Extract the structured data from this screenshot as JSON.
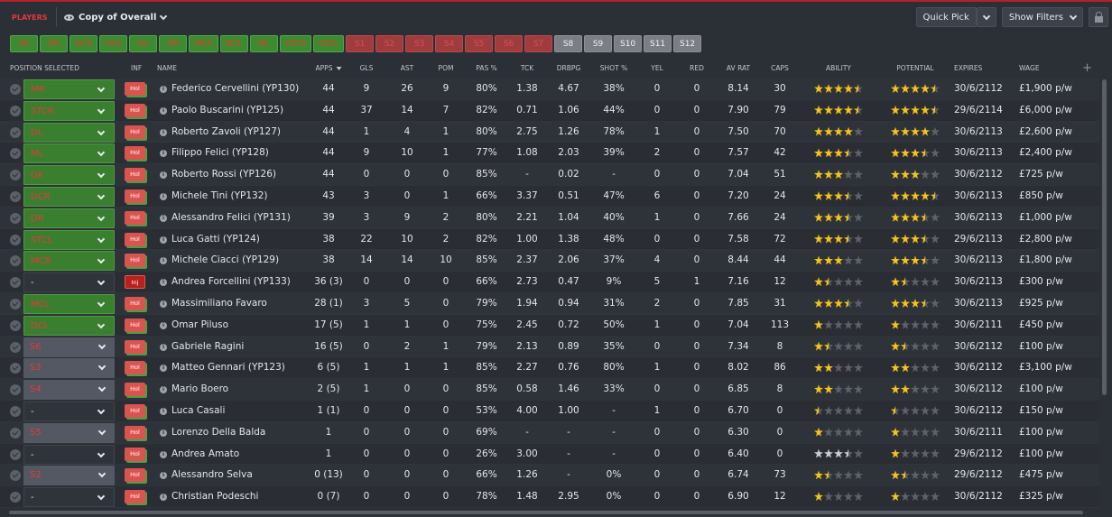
{
  "topbar": {
    "section_tag": "PLAYERS",
    "view_name": "Copy of Overall",
    "quick_pick": "Quick Pick",
    "show_filters": "Show Filters"
  },
  "position_chips": [
    {
      "label": "GK",
      "state": "on"
    },
    {
      "label": "DR",
      "state": "on"
    },
    {
      "label": "DCR",
      "state": "on"
    },
    {
      "label": "DCL",
      "state": "on"
    },
    {
      "label": "DL",
      "state": "on"
    },
    {
      "label": "MR",
      "state": "on"
    },
    {
      "label": "MCR",
      "state": "on"
    },
    {
      "label": "MCL",
      "state": "on"
    },
    {
      "label": "ML",
      "state": "on"
    },
    {
      "label": "STCR",
      "state": "on"
    },
    {
      "label": "STCL",
      "state": "on"
    },
    {
      "label": "S1",
      "state": "off"
    },
    {
      "label": "S2",
      "state": "off"
    },
    {
      "label": "S3",
      "state": "off"
    },
    {
      "label": "S4",
      "state": "off"
    },
    {
      "label": "S5",
      "state": "off"
    },
    {
      "label": "S6",
      "state": "off"
    },
    {
      "label": "S7",
      "state": "off"
    },
    {
      "label": "S8",
      "state": "gray"
    },
    {
      "label": "S9",
      "state": "gray"
    },
    {
      "label": "S10",
      "state": "gray"
    },
    {
      "label": "S11",
      "state": "gray"
    },
    {
      "label": "S12",
      "state": "gray"
    }
  ],
  "columns": {
    "position": "POSITION SELECTED",
    "inf": "INF",
    "name": "NAME",
    "apps": "APPS",
    "gls": "GLS",
    "ast": "AST",
    "pom": "POM",
    "pas": "PAS %",
    "tck": "TCK",
    "drbpg": "DRBPG",
    "shot": "SHOT %",
    "yel": "YEL",
    "red": "RED",
    "avrat": "AV RAT",
    "caps": "CAPS",
    "ability": "ABILITY",
    "potential": "POTENTIAL",
    "expires": "EXPIRES",
    "wage": "WAGE"
  },
  "players": [
    {
      "pos": "MR",
      "pos_style": "g",
      "inf": "Hol",
      "name": "Federico Cervellini (YP130)",
      "apps": "44",
      "gls": "9",
      "ast": "26",
      "pom": "9",
      "pas": "80%",
      "tck": "1.38",
      "drbpg": "4.67",
      "shot": "38%",
      "yel": "0",
      "red": "0",
      "avrat": "8.14",
      "caps": "30",
      "ability": 4.5,
      "potential": 4.5,
      "star_tone": "gold",
      "expires": "30/6/2112",
      "wage": "£1,900 p/w"
    },
    {
      "pos": "STCR",
      "pos_style": "g",
      "inf": "Hol",
      "name": "Paolo Buscarini (YP125)",
      "apps": "44",
      "gls": "37",
      "ast": "14",
      "pom": "7",
      "pas": "82%",
      "tck": "0.71",
      "drbpg": "1.06",
      "shot": "44%",
      "yel": "0",
      "red": "0",
      "avrat": "7.90",
      "caps": "79",
      "ability": 4.5,
      "potential": 4.5,
      "star_tone": "gold",
      "expires": "29/6/2114",
      "wage": "£6,000 p/w"
    },
    {
      "pos": "DL",
      "pos_style": "g",
      "inf": "Hol",
      "name": "Roberto Zavoli (YP127)",
      "apps": "44",
      "gls": "1",
      "ast": "4",
      "pom": "1",
      "pas": "80%",
      "tck": "2.75",
      "drbpg": "1.26",
      "shot": "78%",
      "yel": "1",
      "red": "0",
      "avrat": "7.50",
      "caps": "70",
      "ability": 4,
      "potential": 4,
      "star_tone": "gold",
      "expires": "30/6/2113",
      "wage": "£2,600 p/w"
    },
    {
      "pos": "ML",
      "pos_style": "g",
      "inf": "Hol",
      "name": "Filippo Felici (YP128)",
      "apps": "44",
      "gls": "9",
      "ast": "10",
      "pom": "1",
      "pas": "77%",
      "tck": "1.08",
      "drbpg": "2.03",
      "shot": "39%",
      "yel": "2",
      "red": "0",
      "avrat": "7.57",
      "caps": "42",
      "ability": 3.5,
      "potential": 3.5,
      "star_tone": "gold",
      "expires": "30/6/2113",
      "wage": "£2,400 p/w"
    },
    {
      "pos": "GK",
      "pos_style": "g",
      "inf": "Hol",
      "name": "Roberto Rossi (YP126)",
      "apps": "44",
      "gls": "0",
      "ast": "0",
      "pom": "0",
      "pas": "85%",
      "tck": "-",
      "drbpg": "0.02",
      "shot": "-",
      "yel": "0",
      "red": "0",
      "avrat": "7.04",
      "caps": "51",
      "ability": 3,
      "potential": 3,
      "star_tone": "gold",
      "expires": "30/6/2112",
      "wage": "£725 p/w"
    },
    {
      "pos": "DCR",
      "pos_style": "g",
      "inf": "Hol",
      "name": "Michele Tini (YP132)",
      "apps": "43",
      "gls": "3",
      "ast": "0",
      "pom": "1",
      "pas": "66%",
      "tck": "3.37",
      "drbpg": "0.51",
      "shot": "47%",
      "yel": "6",
      "red": "0",
      "avrat": "7.20",
      "caps": "24",
      "ability": 3.5,
      "potential": 4.5,
      "star_tone": "gold",
      "expires": "30/6/2113",
      "wage": "£850 p/w"
    },
    {
      "pos": "DR",
      "pos_style": "g",
      "inf": "Hol",
      "name": "Alessandro Felici (YP131)",
      "apps": "39",
      "gls": "3",
      "ast": "9",
      "pom": "2",
      "pas": "80%",
      "tck": "2.21",
      "drbpg": "1.04",
      "shot": "40%",
      "yel": "1",
      "red": "0",
      "avrat": "7.66",
      "caps": "24",
      "ability": 3.5,
      "potential": 3.5,
      "star_tone": "gold",
      "expires": "30/6/2113",
      "wage": "£1,000 p/w"
    },
    {
      "pos": "STCL",
      "pos_style": "g",
      "inf": "Hol",
      "name": "Luca Gatti (YP124)",
      "apps": "38",
      "gls": "22",
      "ast": "10",
      "pom": "2",
      "pas": "82%",
      "tck": "1.00",
      "drbpg": "1.38",
      "shot": "48%",
      "yel": "0",
      "red": "0",
      "avrat": "7.58",
      "caps": "72",
      "ability": 3.5,
      "potential": 3.5,
      "star_tone": "gold",
      "expires": "29/6/2113",
      "wage": "£2,800 p/w"
    },
    {
      "pos": "MCR",
      "pos_style": "g",
      "inf": "Hol",
      "name": "Michele Ciacci (YP129)",
      "apps": "38",
      "gls": "14",
      "ast": "14",
      "pom": "10",
      "pas": "85%",
      "tck": "2.37",
      "drbpg": "2.06",
      "shot": "37%",
      "yel": "4",
      "red": "0",
      "avrat": "8.44",
      "caps": "44",
      "ability": 3,
      "potential": 3.5,
      "star_tone": "gold",
      "expires": "30/6/2113",
      "wage": "£1,800 p/w"
    },
    {
      "pos": "-",
      "pos_style": "n",
      "inf": "Inj",
      "name": "Andrea Forcellini (YP133)",
      "apps": "36 (3)",
      "gls": "0",
      "ast": "0",
      "pom": "0",
      "pas": "66%",
      "tck": "2.73",
      "drbpg": "0.47",
      "shot": "9%",
      "yel": "5",
      "red": "1",
      "avrat": "7.16",
      "caps": "12",
      "ability": 1.5,
      "potential": 1.5,
      "star_tone": "gold",
      "expires": "30/6/2113",
      "wage": "£300 p/w"
    },
    {
      "pos": "MCL",
      "pos_style": "g",
      "inf": "Hol",
      "name": "Massimiliano Favaro",
      "apps": "28 (1)",
      "gls": "3",
      "ast": "5",
      "pom": "0",
      "pas": "79%",
      "tck": "1.94",
      "drbpg": "0.94",
      "shot": "31%",
      "yel": "2",
      "red": "0",
      "avrat": "7.85",
      "caps": "31",
      "ability": 3.5,
      "potential": 3.5,
      "star_tone": "gold",
      "expires": "30/6/2113",
      "wage": "£925 p/w"
    },
    {
      "pos": "DCL",
      "pos_style": "g",
      "inf": "Hol",
      "name": "Omar Piluso",
      "apps": "17 (5)",
      "gls": "1",
      "ast": "1",
      "pom": "0",
      "pas": "75%",
      "tck": "2.45",
      "drbpg": "0.72",
      "shot": "50%",
      "yel": "1",
      "red": "0",
      "avrat": "7.04",
      "caps": "113",
      "ability": 1,
      "potential": 1,
      "star_tone": "gold",
      "expires": "30/6/2111",
      "wage": "£450 p/w"
    },
    {
      "pos": "S6",
      "pos_style": "s",
      "inf": "Hol",
      "name": "Gabriele Ragini",
      "apps": "16 (5)",
      "gls": "0",
      "ast": "2",
      "pom": "1",
      "pas": "79%",
      "tck": "2.13",
      "drbpg": "0.89",
      "shot": "35%",
      "yel": "0",
      "red": "0",
      "avrat": "7.34",
      "caps": "8",
      "ability": 1.5,
      "potential": 1.5,
      "star_tone": "gold",
      "expires": "30/6/2112",
      "wage": "£100 p/w"
    },
    {
      "pos": "S3",
      "pos_style": "s",
      "inf": "Hol",
      "name": "Matteo Gennari (YP123)",
      "apps": "6 (5)",
      "gls": "1",
      "ast": "1",
      "pom": "1",
      "pas": "85%",
      "tck": "2.27",
      "drbpg": "0.76",
      "shot": "80%",
      "yel": "1",
      "red": "0",
      "avrat": "8.02",
      "caps": "86",
      "ability": 2,
      "potential": 2,
      "star_tone": "gold",
      "expires": "30/6/2112",
      "wage": "£3,100 p/w"
    },
    {
      "pos": "S4",
      "pos_style": "s",
      "inf": "Hol",
      "name": "Mario Boero",
      "apps": "2 (5)",
      "gls": "1",
      "ast": "0",
      "pom": "0",
      "pas": "85%",
      "tck": "0.58",
      "drbpg": "1.46",
      "shot": "33%",
      "yel": "0",
      "red": "0",
      "avrat": "6.85",
      "caps": "8",
      "ability": 2,
      "potential": 2,
      "star_tone": "gold",
      "expires": "30/6/2112",
      "wage": "£100 p/w"
    },
    {
      "pos": "-",
      "pos_style": "n",
      "inf": "Hol",
      "name": "Luca Casali",
      "apps": "1 (1)",
      "gls": "0",
      "ast": "0",
      "pom": "0",
      "pas": "53%",
      "tck": "4.00",
      "drbpg": "1.00",
      "shot": "-",
      "yel": "1",
      "red": "0",
      "avrat": "6.70",
      "caps": "0",
      "ability": 0.5,
      "potential": 0.5,
      "star_tone": "gold",
      "expires": "30/6/2112",
      "wage": "£150 p/w"
    },
    {
      "pos": "S5",
      "pos_style": "s",
      "inf": "Hol",
      "name": "Lorenzo Della Balda",
      "apps": "1",
      "gls": "0",
      "ast": "0",
      "pom": "0",
      "pas": "69%",
      "tck": "-",
      "drbpg": "-",
      "shot": "-",
      "yel": "0",
      "red": "0",
      "avrat": "6.30",
      "caps": "0",
      "ability": 1,
      "potential": 1,
      "star_tone": "gold",
      "expires": "30/6/2111",
      "wage": "£100 p/w"
    },
    {
      "pos": "-",
      "pos_style": "n",
      "inf": "Hol",
      "name": "Andrea Amato",
      "apps": "1",
      "gls": "0",
      "ast": "0",
      "pom": "0",
      "pas": "26%",
      "tck": "3.00",
      "drbpg": "-",
      "shot": "-",
      "yel": "0",
      "red": "0",
      "avrat": "6.40",
      "caps": "0",
      "ability": 3.5,
      "potential": 1,
      "star_tone": "mixed",
      "expires": "29/6/2112",
      "wage": "£100 p/w"
    },
    {
      "pos": "S2",
      "pos_style": "s",
      "inf": "Hol",
      "name": "Alessandro Selva",
      "apps": "0 (13)",
      "gls": "0",
      "ast": "0",
      "pom": "0",
      "pas": "66%",
      "tck": "1.26",
      "drbpg": "-",
      "shot": "0%",
      "yel": "0",
      "red": "0",
      "avrat": "6.74",
      "caps": "73",
      "ability": 1.5,
      "potential": 1.5,
      "star_tone": "gold",
      "expires": "29/6/2112",
      "wage": "£475 p/w"
    },
    {
      "pos": "-",
      "pos_style": "n",
      "inf": "Hol",
      "name": "Christian Podeschi",
      "apps": "0 (7)",
      "gls": "0",
      "ast": "0",
      "pom": "0",
      "pas": "78%",
      "tck": "1.48",
      "drbpg": "2.95",
      "shot": "0%",
      "yel": "0",
      "red": "0",
      "avrat": "6.90",
      "caps": "12",
      "ability": 1,
      "potential": 1,
      "star_tone": "gold",
      "expires": "30/6/2112",
      "wage": "£325 p/w"
    }
  ]
}
